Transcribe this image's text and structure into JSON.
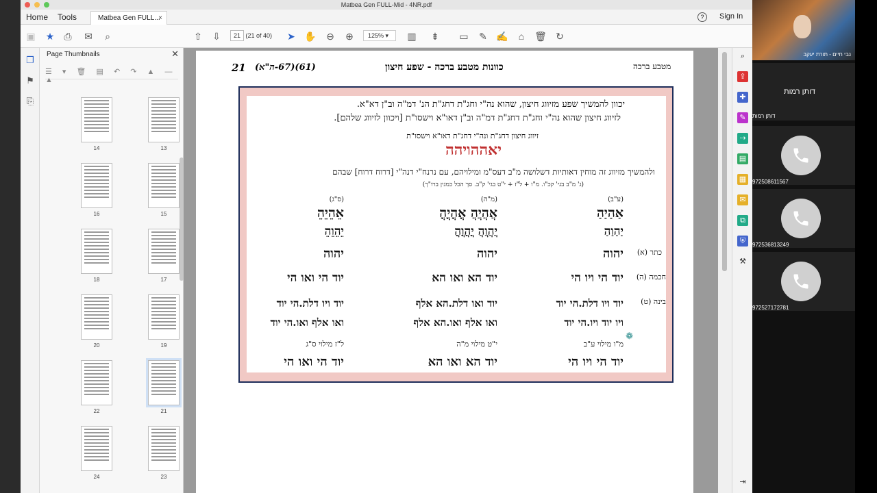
{
  "app": {
    "window_title": "Matbea Gen FULL-Mid - 4NR.pdf",
    "menu": {
      "home": "Home",
      "tools": "Tools"
    },
    "tab_label": "Matbea Gen FULL...",
    "sign_in": "Sign In",
    "help_icon": "?"
  },
  "toolbar": {
    "page_current": "21",
    "page_count": "(21 of 40)",
    "zoom": "125%"
  },
  "thumbnails": {
    "title": "Page Thumbnails",
    "pages": [
      {
        "label": "14"
      },
      {
        "label": "13"
      },
      {
        "label": "16"
      },
      {
        "label": "15"
      },
      {
        "label": "18"
      },
      {
        "label": "17"
      },
      {
        "label": "20"
      },
      {
        "label": "19"
      },
      {
        "label": "22"
      },
      {
        "label": "21"
      },
      {
        "label": "24"
      },
      {
        "label": "23"
      }
    ],
    "selected": "21"
  },
  "document": {
    "header_left": "21",
    "header_left2": "(61)(67-ה\"א)",
    "header_center": "כוונות מטבע ברכה - שפע חיצון",
    "header_right": "מטבע ברכה",
    "intro_line1": "יכוון להמשיך שפע מזיווג חיצון, שהוא נה\"י וחג\"ת דחג\"ת הנ' דמ\"ה וב\"ן דא\"א.",
    "intro_line2": "לזיווג חיצון שהוא נה\"י וחג\"ת דחג\"ת דמ\"ה וב\"ן דאו\"א וישסו\"ת [ויכוון לזיווג שלהם].",
    "zivug_title": "זיווג חיצון דחג\"ת ונה\"י דחג\"ת דאו\"א וישסו\"ת",
    "colored_name": "יאההויהה",
    "continue_line": "ולהמשיך מזיווג זה מוחין דאותיות דשלושה מ\"ב דעס\"מ ומילויהם, עם נרנח\"י דנה\"י [דרוח דרוח] שבהם",
    "sub_line": "(ג' מ\"ב בגי' קכ\"ו. מ\"ו + ל\"ז + י\"ט בגי' ק\"ב. סך הכל כמנין ברו\"ך)",
    "row_labels": {
      "keter": "כתר (א)",
      "chochma": "חכמה (ה)",
      "bina": "בינה (ט)"
    },
    "columns": [
      {
        "head": "(ע\"ב)",
        "line1": "אַהַיַהַ",
        "line2": "יַהַוַהַ",
        "line3": "יהוה",
        "line4": "יוד הי ויו הי",
        "line5": "יוד ויו דלת.הי יוד",
        "line6": "ויו יוד ויו.הי יוד",
        "milui": "מ\"ו מילוי ע\"ב",
        "bottom": "יוד הי ויו הי"
      },
      {
        "head": "(מ\"ה)",
        "line1": "אֲהֲיֲהֲ אֳהֳיֳהֳ",
        "line2": "יֲהֲוֲהֲ יֳהֳוֳהֳ",
        "line3": "יהוה",
        "line4": "יוד הא ואו הא",
        "line5": "יוד ואו דלת.הא אלף",
        "line6": "ואו אלף ואו.הא אלף",
        "milui": "י\"ט מילוי מ\"ה",
        "bottom": "יוד הא ואו הא"
      },
      {
        "head": "(ס\"ג)",
        "line1": "אֵהֵיֵהֵ",
        "line2": "יֵהֵוֵהֵ",
        "line3": "יהוה",
        "line4": "יוד הי ואו הי",
        "line5": "יוד ויו דלת.הי יוד",
        "line6": "ואו אלף ואו.הי יוד",
        "milui": "ל\"ז מילוי ס\"ג",
        "bottom": "יוד הי ואו הי"
      }
    ]
  },
  "video_call": {
    "top_name": "נבי חיים - תורת יעקב",
    "active_name": "דותן רמות",
    "active_name_small": "דותן רמות",
    "participants": [
      "972508611567",
      "972536813249",
      "972527172781"
    ]
  },
  "colors": {
    "frame_border": "#1d2d5a",
    "frame_fill": "#f1c9c5",
    "accent_blue": "#2b62c9"
  }
}
